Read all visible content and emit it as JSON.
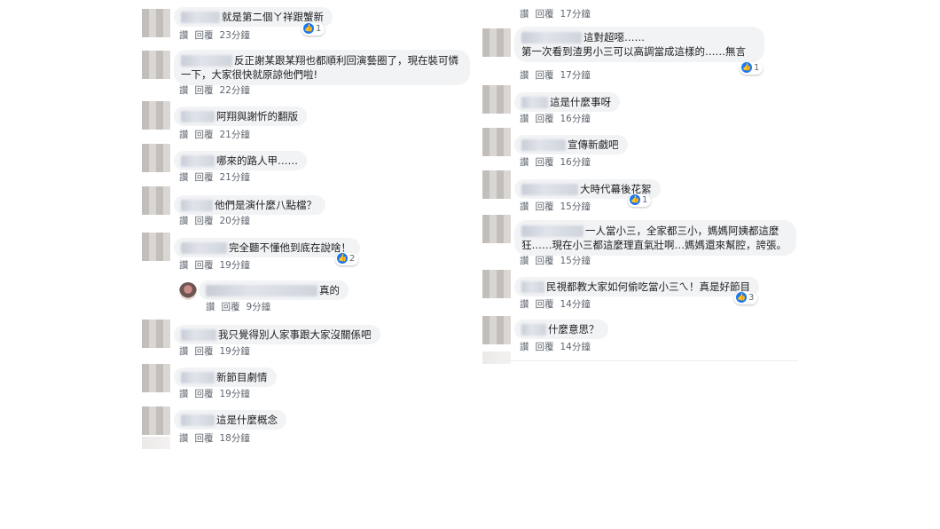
{
  "labels": {
    "like": "讚",
    "reply": "回覆"
  },
  "left_comments": [
    {
      "text": "就是第二個ㄚ祥跟蟹新",
      "time": "23分鐘",
      "reactions": "1"
    },
    {
      "text": "反正謝某跟某翔也都順利回演藝圈了，現在裝可憐一下，大家很快就原諒他們啦!",
      "time": "22分鐘"
    },
    {
      "text": "阿翔與謝忻的翻版",
      "time": "21分鐘"
    },
    {
      "text": "哪來的路人甲……",
      "time": "21分鐘"
    },
    {
      "text": "他們是演什麼八點檔？",
      "time": "20分鐘"
    },
    {
      "text": "完全聽不懂他到底在說啥！",
      "time": "19分鐘",
      "reactions": "2"
    },
    {
      "text": "真的",
      "time": "9分鐘"
    },
    {
      "text": "我只覺得別人家事跟大家沒關係吧",
      "time": "19分鐘"
    },
    {
      "text": "新節目劇情",
      "time": "19分鐘"
    },
    {
      "text": "這是什麼概念",
      "time": "18分鐘"
    }
  ],
  "right_comments": [
    {
      "time": "17分鐘"
    },
    {
      "text": "這對超噁……",
      "text2": "第一次看到渣男小三可以高調當成這樣的……無言",
      "time": "17分鐘",
      "reactions": "1"
    },
    {
      "text": "這是什麼事呀",
      "time": "16分鐘"
    },
    {
      "text": "宣傳新戲吧",
      "time": "16分鐘"
    },
    {
      "text": "大時代幕後花絮",
      "time": "15分鐘",
      "reactions": "1"
    },
    {
      "text": "一人當小三，全家都三小，媽媽阿姨都這麼狂……現在小三都這麼理直氣壯啊…媽媽還來幫腔，誇張。",
      "time": "15分鐘"
    },
    {
      "text": "民視都教大家如何偷吃當小三ㄟ！真是好節目",
      "time": "14分鐘",
      "reactions": "3"
    },
    {
      "text": "什麼意思？",
      "time": "14分鐘"
    }
  ],
  "colors": {
    "bubble": "#f2f3f5",
    "meta": "#606770",
    "like_blue": "#1877f2"
  }
}
